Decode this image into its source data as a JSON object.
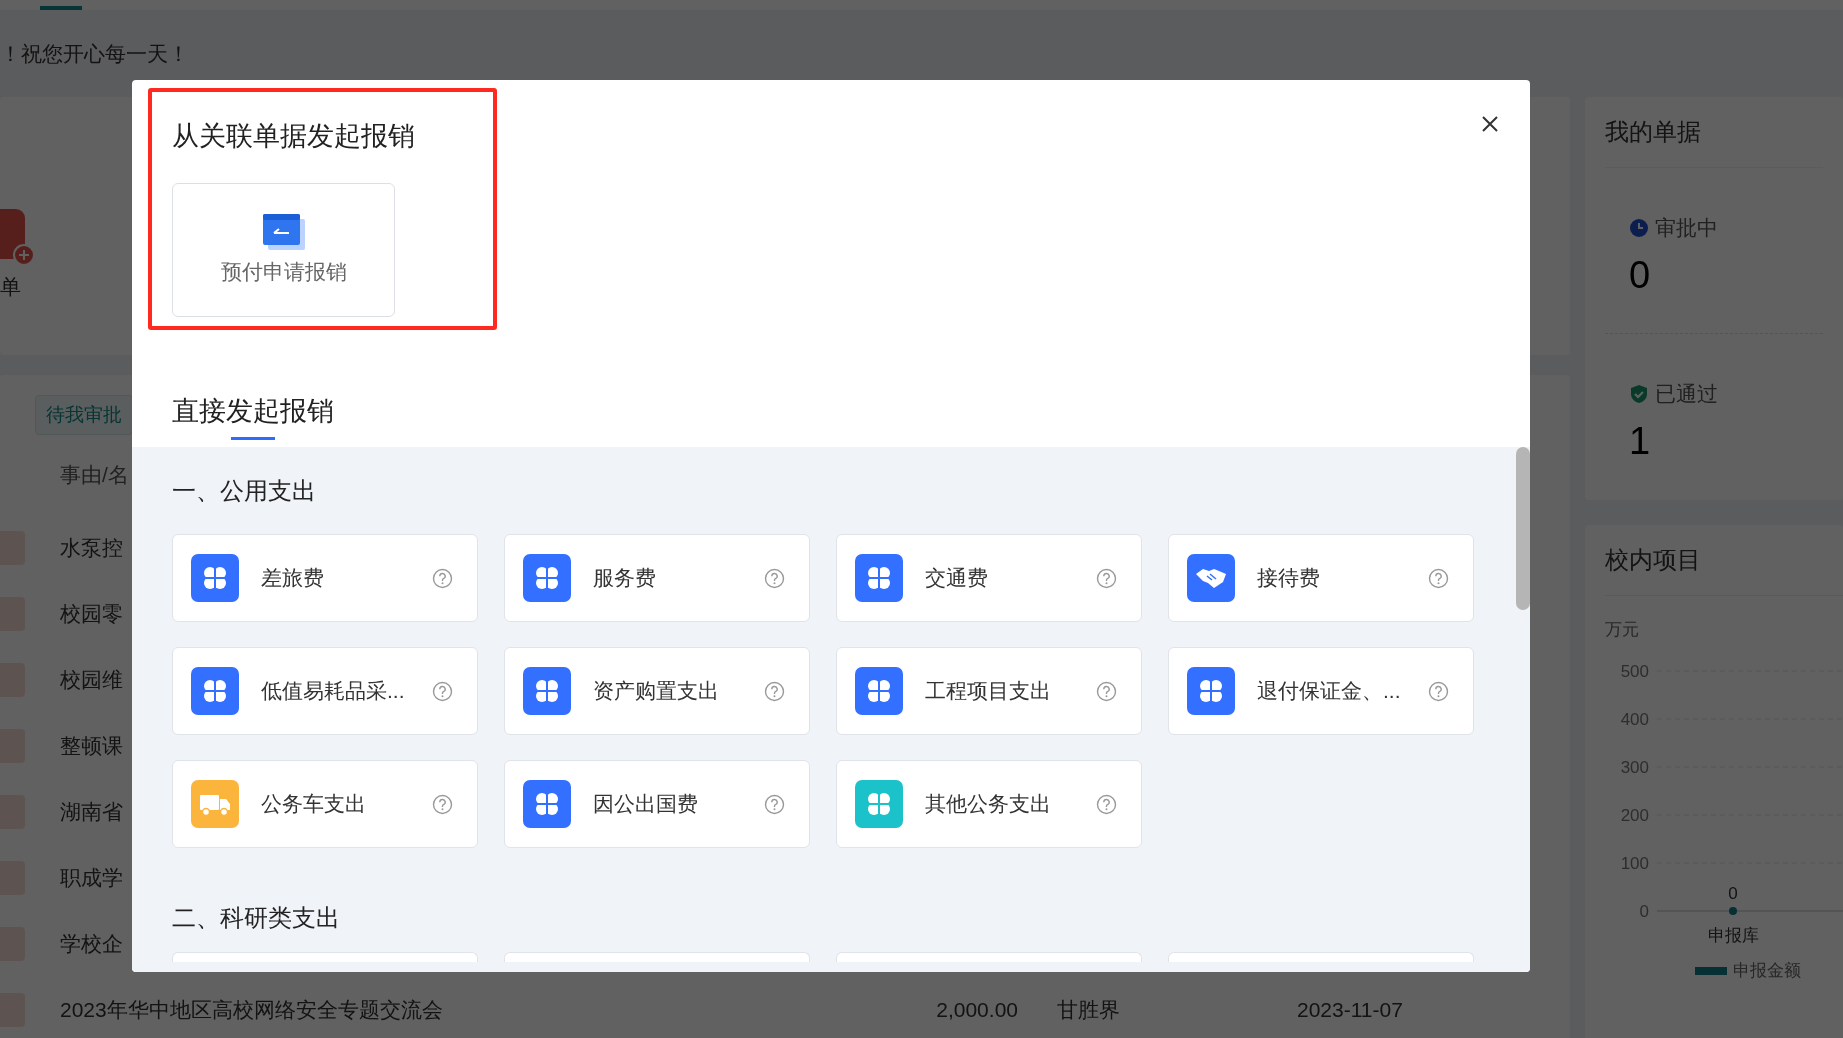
{
  "header": {
    "greeting": "！祝您开心每一天！"
  },
  "shortcut": {
    "label": "单"
  },
  "tasks": {
    "tabs": [
      {
        "label": "待我审批",
        "selected": true
      }
    ],
    "columns": [
      "事由/名"
    ],
    "rows": [
      {
        "title": "水泵控"
      },
      {
        "title": "校园零"
      },
      {
        "title": "校园维"
      },
      {
        "title": "整顿课"
      },
      {
        "title": "湖南省"
      },
      {
        "title": "职成学"
      },
      {
        "title": "学校企"
      },
      {
        "title": "2023年华中地区高校网络安全专题交流会",
        "amount": "2,000.00",
        "applicant": "甘胜界",
        "date": "2023-11-07"
      }
    ]
  },
  "my_documents": {
    "title": "我的单据",
    "stats": [
      {
        "label": "审批中",
        "value": "0",
        "kind": "pending"
      },
      {
        "label": "已通过",
        "value": "1",
        "kind": "approved"
      }
    ]
  },
  "campus_projects": {
    "title": "校内项目",
    "chart_data": {
      "type": "line",
      "ylabel": "万元",
      "categories": [
        "申报库"
      ],
      "series": [
        {
          "name": "申报金额",
          "color": "#137f8c",
          "marker": "circle",
          "values": [
            0
          ]
        }
      ],
      "ylim": [
        0,
        500
      ],
      "yticks": [
        0,
        100,
        200,
        300,
        400,
        500
      ],
      "grid": true,
      "data_labels": true
    }
  },
  "modal": {
    "linked": {
      "title": "从关联单据发起报销",
      "highlighted": true,
      "options": [
        {
          "label": "预付申请报销"
        }
      ]
    },
    "direct": {
      "tabs": [
        {
          "label": "直接发起报销",
          "selected": true
        }
      ],
      "sections": [
        {
          "title": "一、公用支出",
          "items": [
            {
              "label": "差旅费",
              "kind": "clover",
              "color": "#3370ff"
            },
            {
              "label": "服务费",
              "kind": "clover",
              "color": "#3370ff"
            },
            {
              "label": "交通费",
              "kind": "clover",
              "color": "#3370ff"
            },
            {
              "label": "接待费",
              "kind": "handshake",
              "color": "#3370ff"
            },
            {
              "label": "低值易耗品采...",
              "kind": "clover",
              "color": "#3370ff"
            },
            {
              "label": "资产购置支出",
              "kind": "clover",
              "color": "#3370ff"
            },
            {
              "label": "工程项目支出",
              "kind": "clover",
              "color": "#3370ff"
            },
            {
              "label": "退付保证金、...",
              "kind": "clover",
              "color": "#3370ff"
            },
            {
              "label": "公务车支出",
              "kind": "vehicle",
              "color": "#fbb53c"
            },
            {
              "label": "因公出国费",
              "kind": "clover",
              "color": "#3370ff"
            },
            {
              "label": "其他公务支出",
              "kind": "clover",
              "color": "#1cc2c9"
            }
          ]
        },
        {
          "title": "二、科研类支出",
          "items": [
            {
              "kind": "cut"
            },
            {
              "kind": "cut"
            },
            {
              "kind": "cut"
            },
            {
              "kind": "cut"
            }
          ]
        }
      ]
    }
  }
}
